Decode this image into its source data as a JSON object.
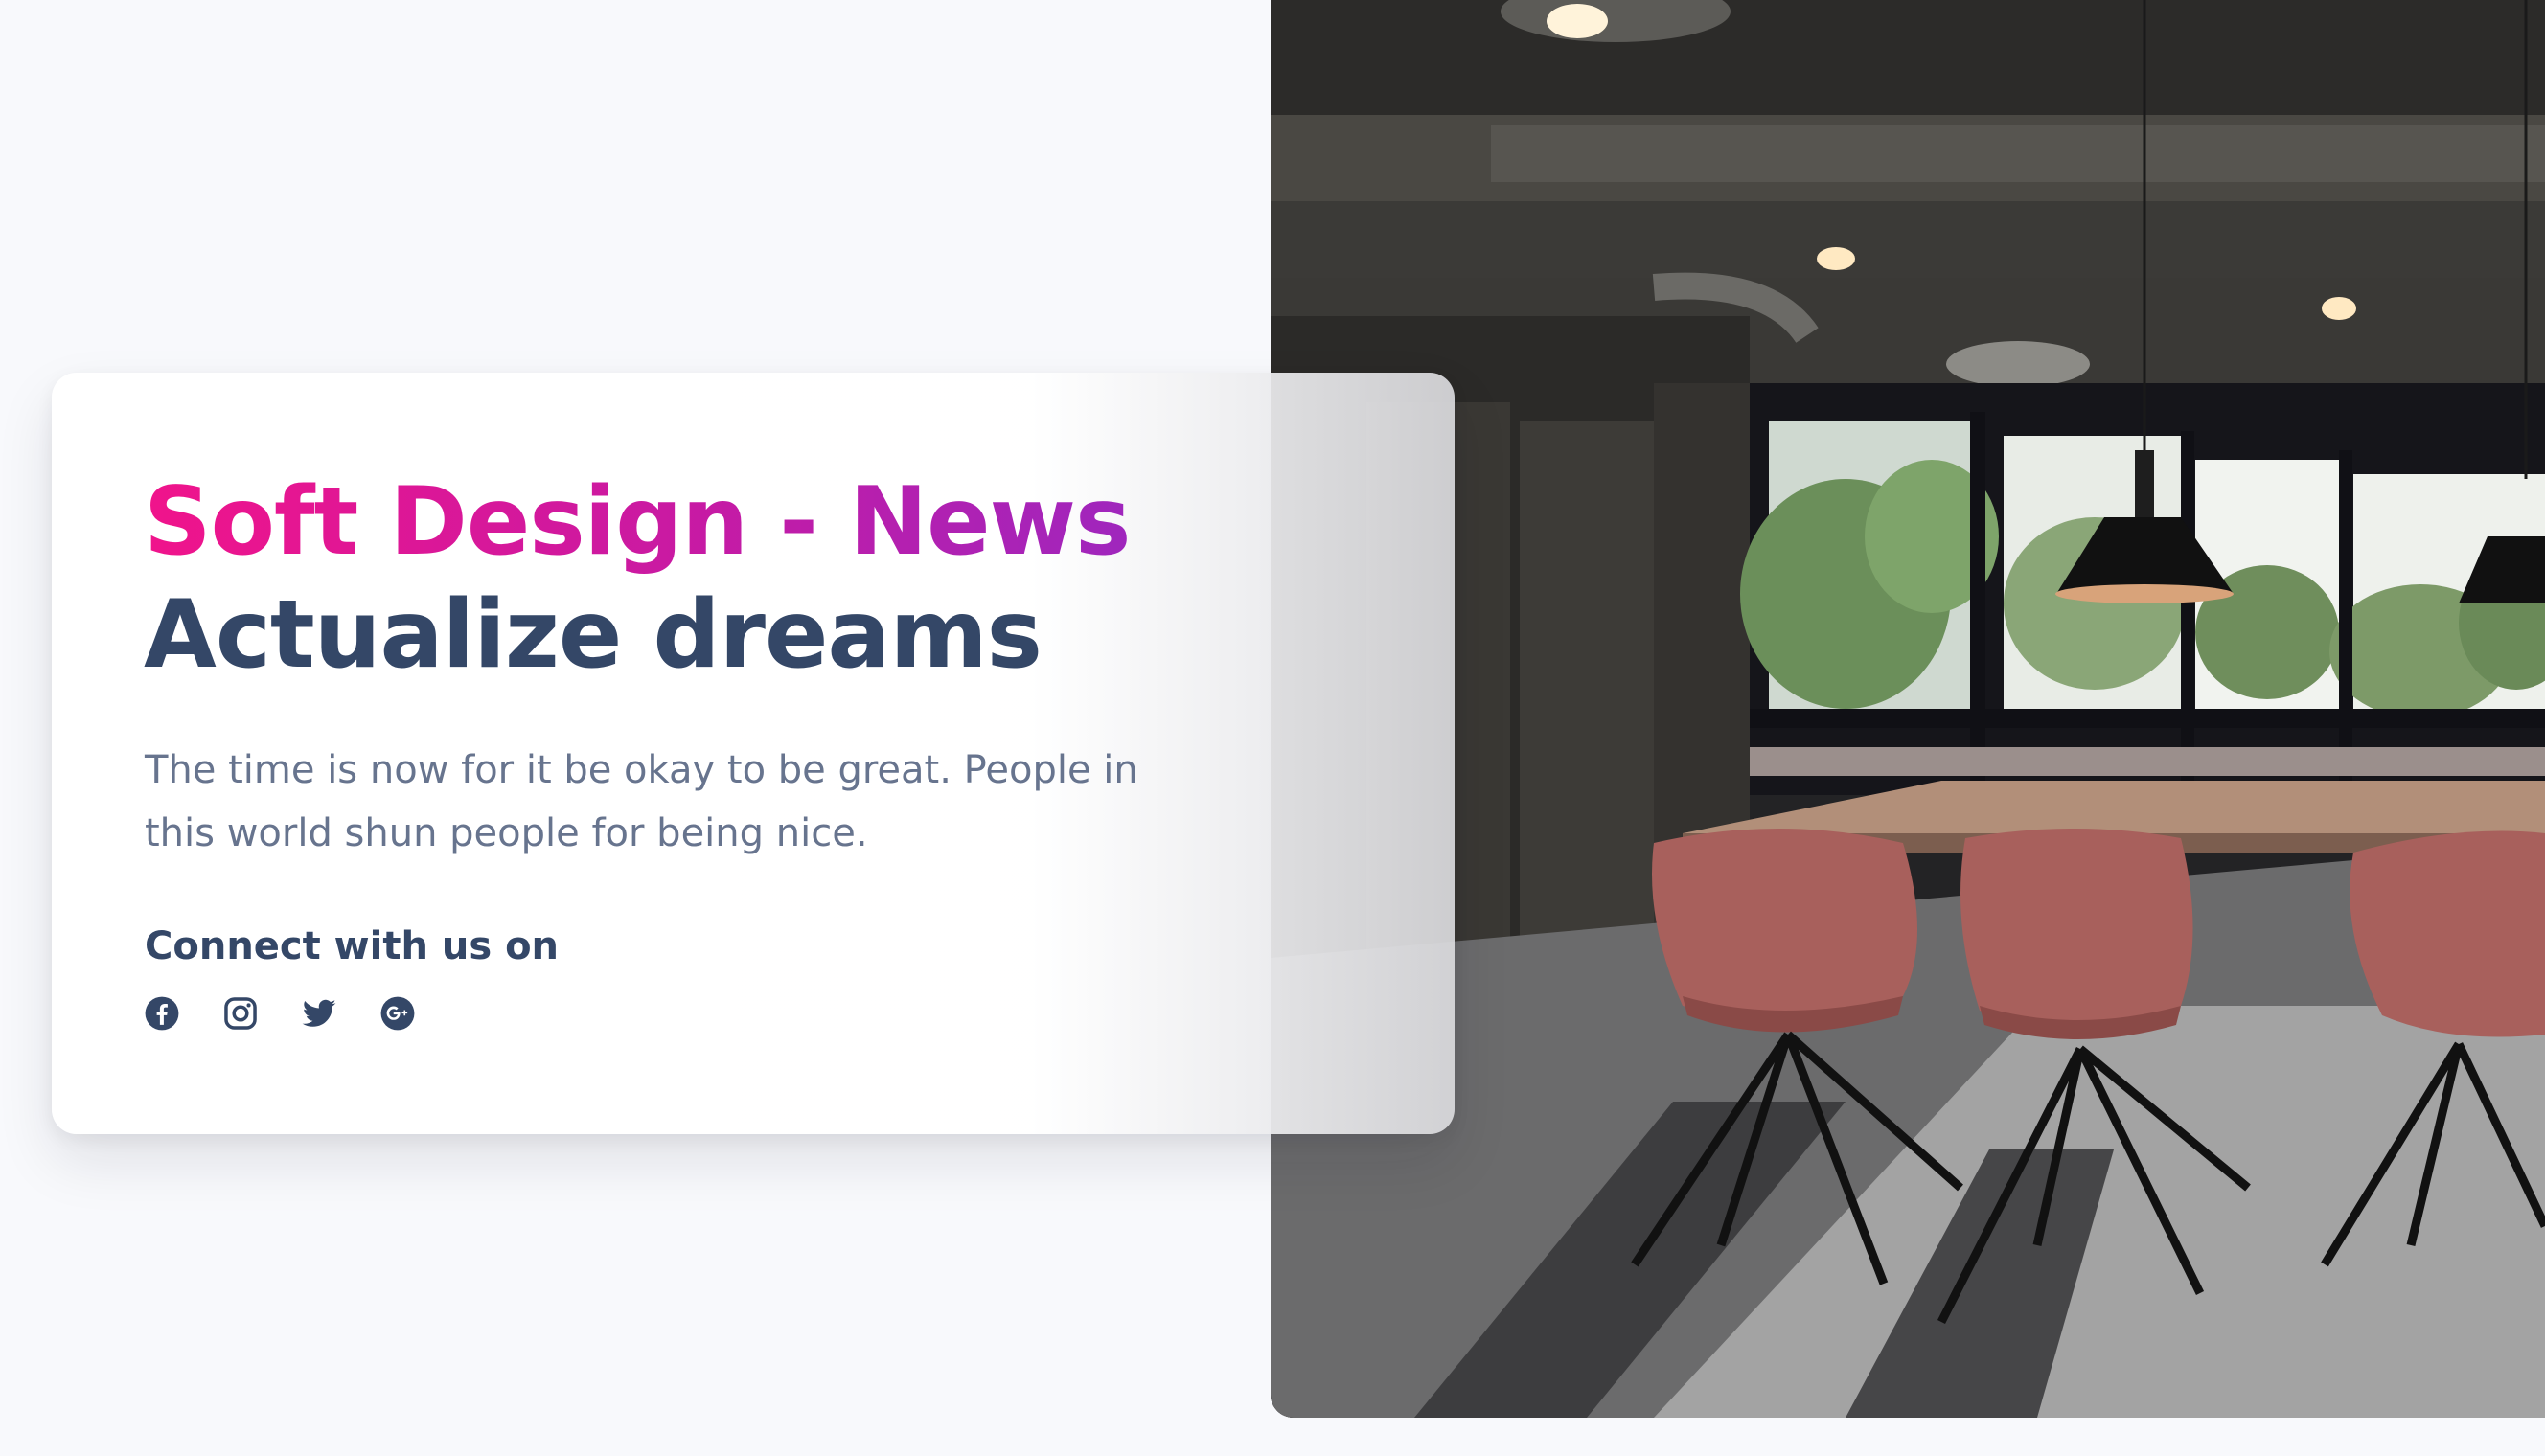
{
  "hero": {
    "title": "Soft Design - News",
    "headline": "Actualize dreams",
    "description": "The time is now for it be okay to be great. People in this world shun people for being nice.",
    "connect_label": "Connect with us on",
    "socials": [
      {
        "icon": "facebook-icon"
      },
      {
        "icon": "instagram-icon"
      },
      {
        "icon": "twitter-icon"
      },
      {
        "icon": "google-plus-icon"
      }
    ]
  },
  "colors": {
    "gradient_start": "#f0148b",
    "gradient_end": "#9f26bd",
    "heading": "#344767",
    "body_text": "#67748e",
    "page_background": "#f8f9fc"
  }
}
